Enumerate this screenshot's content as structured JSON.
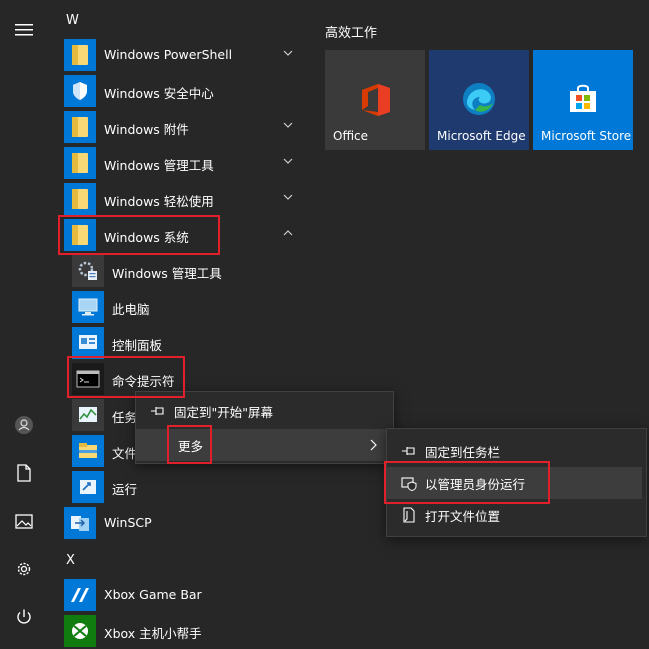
{
  "rail": {
    "icons": [
      "hamburger-menu-icon",
      "user-icon",
      "document-icon",
      "pictures-icon",
      "gear-icon",
      "power-icon"
    ]
  },
  "app_list": {
    "letter_w": "W",
    "items": [
      {
        "label": "Windows PowerShell"
      },
      {
        "label": "Windows 安全中心"
      },
      {
        "label": "Windows 附件"
      },
      {
        "label": "Windows 管理工具"
      },
      {
        "label": "Windows 轻松使用"
      },
      {
        "label": "Windows 系统"
      }
    ],
    "sub_items": [
      {
        "label": "Windows 管理工具"
      },
      {
        "label": "此电脑"
      },
      {
        "label": "控制面板"
      },
      {
        "label": "命令提示符"
      },
      {
        "label": "任务"
      },
      {
        "label": "文件"
      },
      {
        "label": "运行"
      }
    ],
    "winscp": "WinSCP",
    "letter_x": "X",
    "x_items": [
      {
        "label": "Xbox Game Bar"
      },
      {
        "label": "Xbox 主机小帮手"
      }
    ]
  },
  "tiles": {
    "group_title": "高效工作",
    "items": [
      {
        "name": "Office",
        "bg": "#3a3a3a"
      },
      {
        "name": "Microsoft Edge",
        "bg": "#1e3a6e"
      },
      {
        "name": "Microsoft Store",
        "bg": "#0078d7"
      }
    ]
  },
  "context_menu": {
    "pin_start": "固定到\"开始\"屏幕",
    "more": "更多"
  },
  "sub_menu": {
    "pin_taskbar": "固定到任务栏",
    "run_as_admin": "以管理员身份运行",
    "open_location": "打开文件位置"
  },
  "colors": {
    "background": "#272727",
    "accent": "#0078d7",
    "highlight_box": "#e0202a",
    "menu_bg": "#2b2b2b",
    "selected_bg": "#3d3d3d"
  }
}
